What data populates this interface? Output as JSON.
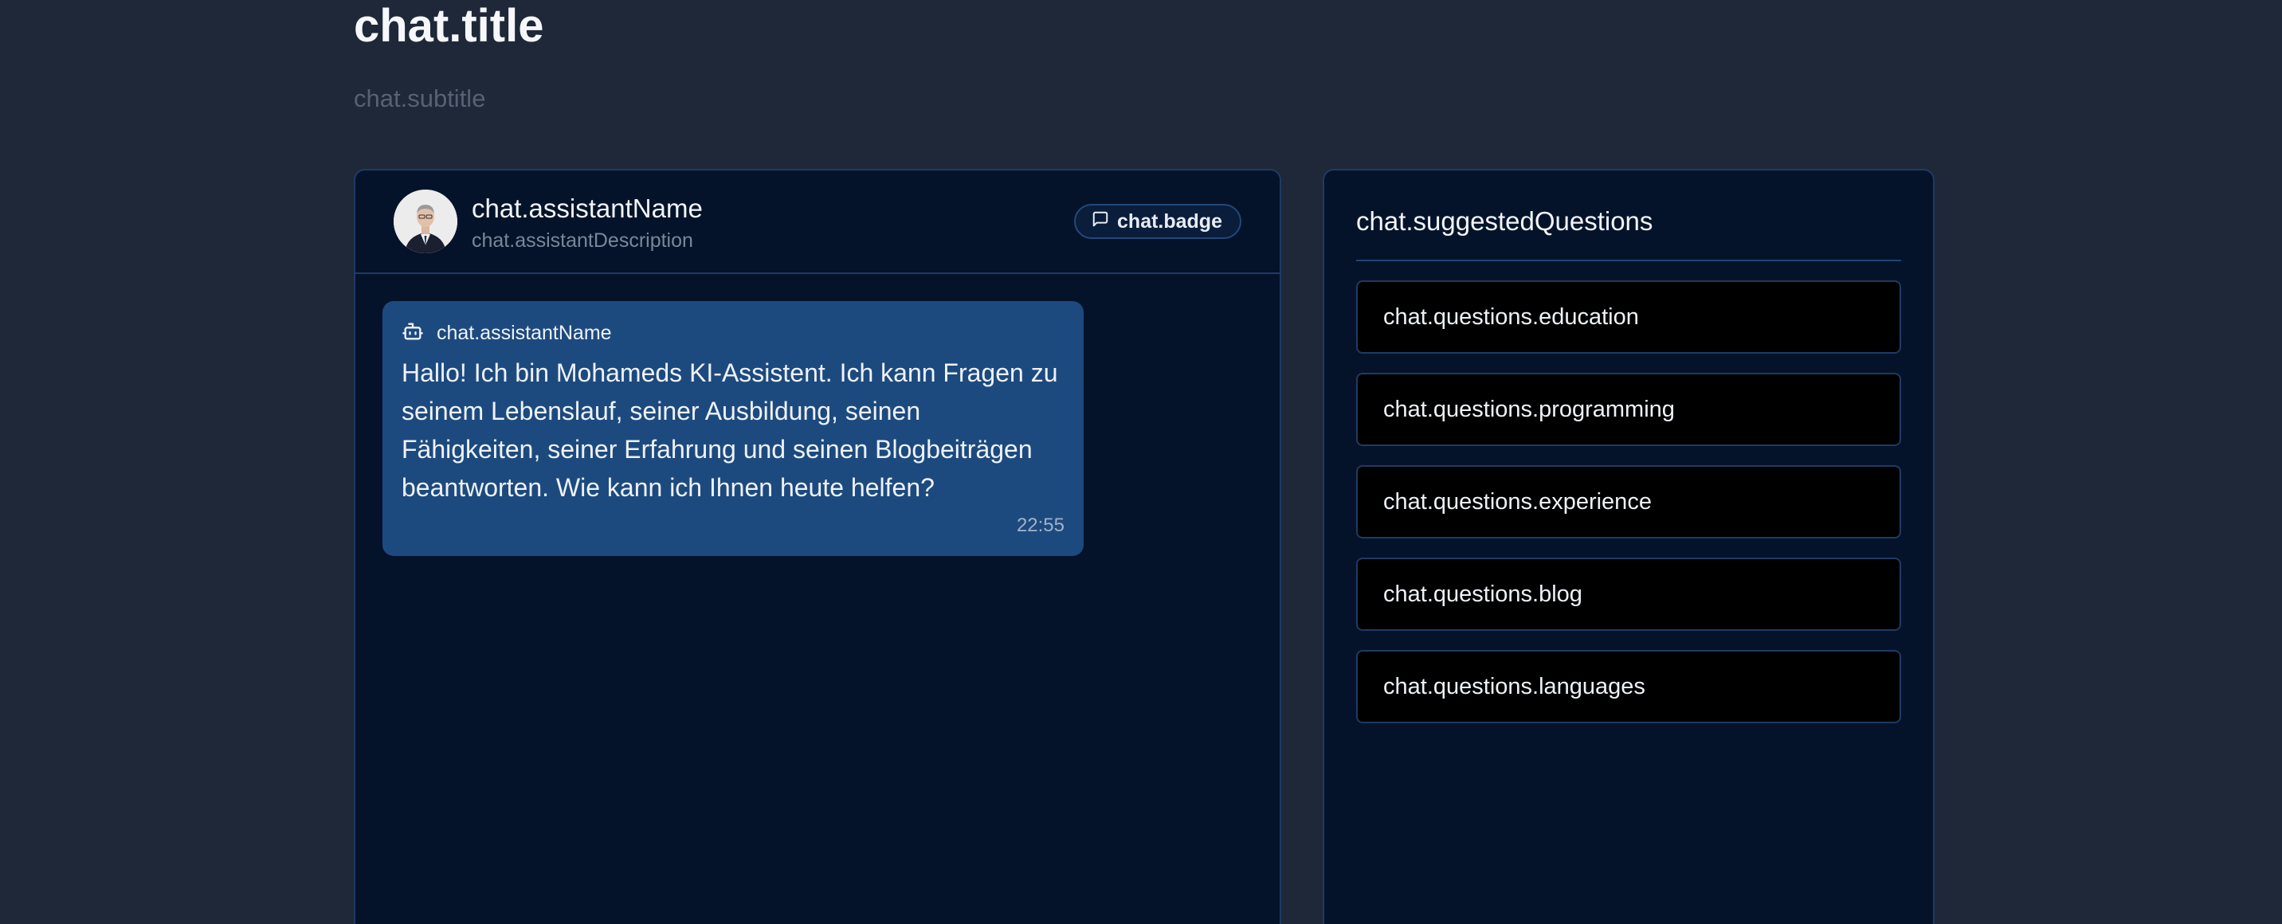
{
  "page": {
    "title": "chat.title",
    "subtitle": "chat.subtitle"
  },
  "chat": {
    "header": {
      "assistant_name": "chat.assistantName",
      "assistant_description": "chat.assistantDescription",
      "badge": "chat.badge",
      "badge_icon": "message-square-icon",
      "avatar_icon": "avatar-photo"
    },
    "messages": [
      {
        "sender": "chat.assistantName",
        "sender_icon": "bot-icon",
        "text": "Hallo! Ich bin Mohameds KI-Assistent. Ich kann Fragen zu seinem Lebenslauf, seiner Ausbildung, seinen Fähigkeiten, seiner Erfahrung und seinen Blogbeiträgen beantworten. Wie kann ich Ihnen heute helfen?",
        "time": "22:55"
      }
    ]
  },
  "sidebar": {
    "title": "chat.suggestedQuestions",
    "questions": [
      "chat.questions.education",
      "chat.questions.programming",
      "chat.questions.experience",
      "chat.questions.blog",
      "chat.questions.languages"
    ]
  },
  "colors": {
    "background": "#1f2838",
    "panel": "#05132a",
    "panel_border": "#1f3a63",
    "message_bubble": "#1d4a7e",
    "question_button": "#000000"
  }
}
